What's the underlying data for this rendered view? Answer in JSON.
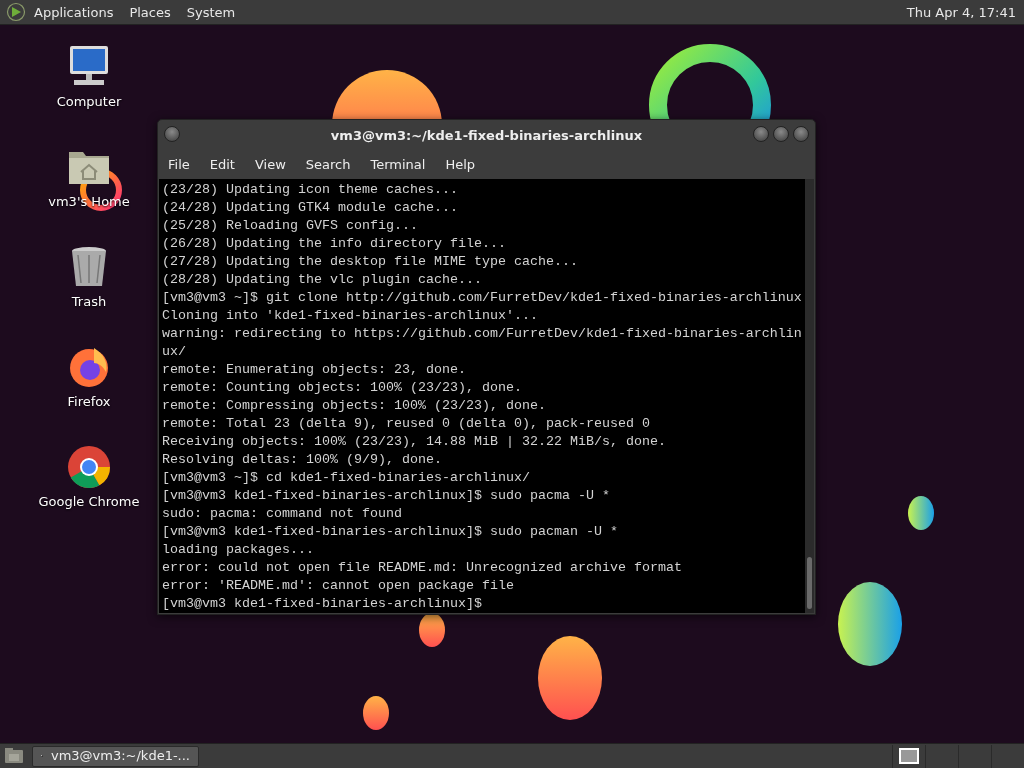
{
  "top_panel": {
    "menus": [
      "Applications",
      "Places",
      "System"
    ],
    "clock": "Thu Apr  4, 17:41"
  },
  "desktop_icons": [
    {
      "label": "Computer",
      "kind": "computer"
    },
    {
      "label": "vm3's Home",
      "kind": "home"
    },
    {
      "label": "Trash",
      "kind": "trash"
    },
    {
      "label": "Firefox",
      "kind": "firefox"
    },
    {
      "label": "Google Chrome",
      "kind": "chrome"
    }
  ],
  "terminal": {
    "title": "vm3@vm3:~/kde1-fixed-binaries-archlinux",
    "menu": [
      "File",
      "Edit",
      "View",
      "Search",
      "Terminal",
      "Help"
    ],
    "lines": [
      "(23/28) Updating icon theme caches...",
      "(24/28) Updating GTK4 module cache...",
      "(25/28) Reloading GVFS config...",
      "(26/28) Updating the info directory file...",
      "(27/28) Updating the desktop file MIME type cache...",
      "(28/28) Updating the vlc plugin cache...",
      "[vm3@vm3 ~]$ git clone http://github.com/FurretDev/kde1-fixed-binaries-archlinux",
      "Cloning into 'kde1-fixed-binaries-archlinux'...",
      "warning: redirecting to https://github.com/FurretDev/kde1-fixed-binaries-archlin",
      "ux/",
      "remote: Enumerating objects: 23, done.",
      "remote: Counting objects: 100% (23/23), done.",
      "remote: Compressing objects: 100% (23/23), done.",
      "remote: Total 23 (delta 9), reused 0 (delta 0), pack-reused 0",
      "Receiving objects: 100% (23/23), 14.88 MiB | 32.22 MiB/s, done.",
      "Resolving deltas: 100% (9/9), done.",
      "[vm3@vm3 ~]$ cd kde1-fixed-binaries-archlinux/",
      "[vm3@vm3 kde1-fixed-binaries-archlinux]$ sudo pacma -U *",
      "sudo: pacma: command not found",
      "[vm3@vm3 kde1-fixed-binaries-archlinux]$ sudo pacman -U *",
      "loading packages...",
      "error: could not open file README.md: Unrecognized archive format",
      "error: 'README.md': cannot open package file",
      "[vm3@vm3 kde1-fixed-binaries-archlinux]$ "
    ]
  },
  "bottom_panel": {
    "tasks": [
      "vm3@vm3:~/kde1-..."
    ]
  }
}
